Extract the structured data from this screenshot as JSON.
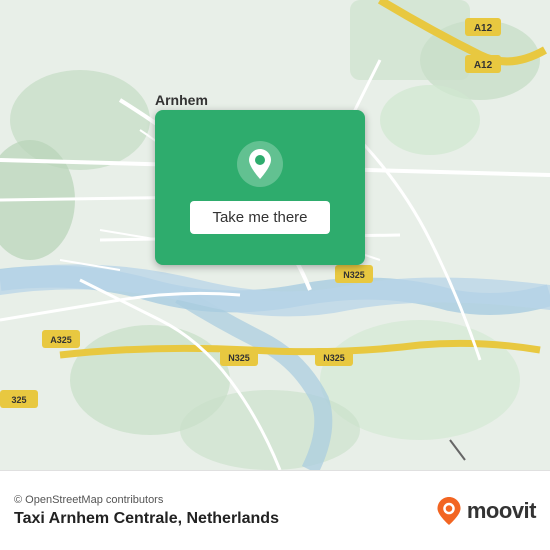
{
  "map": {
    "alt": "Map of Arnhem area, Netherlands",
    "center_city": "Arnhem"
  },
  "card": {
    "button_label": "Take me there",
    "pin_alt": "location pin"
  },
  "footer": {
    "osm_credit": "© OpenStreetMap contributors",
    "location_name": "Taxi Arnhem Centrale, Netherlands",
    "brand_name": "moovit"
  },
  "colors": {
    "card_green": "#2eac6d",
    "moovit_orange": "#f26522",
    "road_yellow": "#f0d060",
    "road_white": "#ffffff",
    "map_green": "#c8e6c9",
    "map_water": "#b3d9f0"
  }
}
